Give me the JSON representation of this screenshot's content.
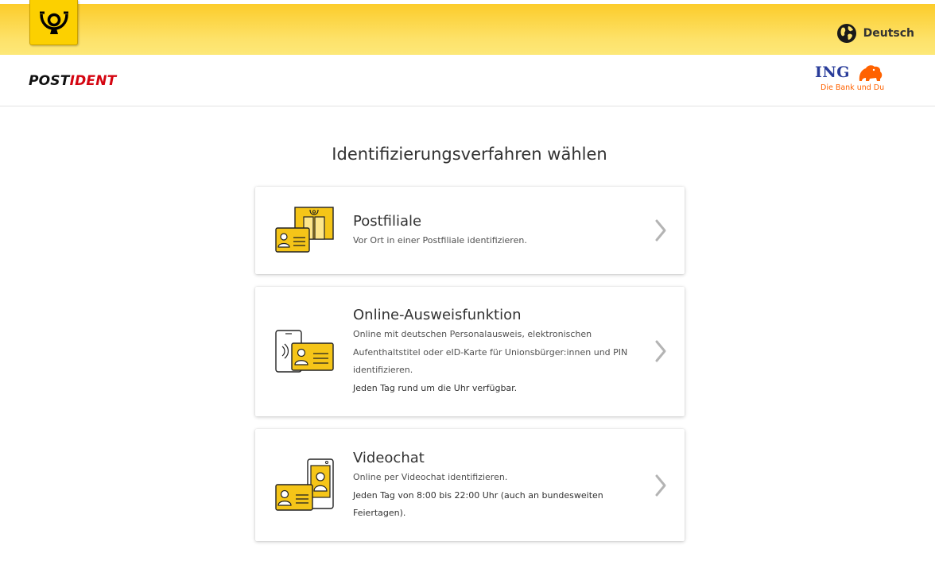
{
  "header": {
    "language_label": "Deutsch",
    "language_icon": "globe-icon",
    "brand_icon": "posthorn-icon"
  },
  "subheader": {
    "postident_part1": "POST",
    "postident_part2": "IDENT",
    "partner_name": "ING",
    "partner_tagline": "Die Bank und Du"
  },
  "page": {
    "title": "Identifizierungsverfahren wählen"
  },
  "options": [
    {
      "title": "Postfiliale",
      "description": "Vor Ort in einer Postfiliale identifizieren.",
      "note": "",
      "icon": "post-office-id-card-icon"
    },
    {
      "title": "Online-Ausweisfunktion",
      "description": "Online mit deutschen Personalausweis, elektronischen Aufenthaltstitel oder eID-Karte für Unionsbürger:innen und PIN identifizieren.",
      "note": "Jeden Tag rund um die Uhr verfügbar.",
      "icon": "phone-nfc-id-card-icon"
    },
    {
      "title": "Videochat",
      "description": "Online per Videochat identifizieren.",
      "note": "Jeden Tag von 8:00 bis 22:00 Uhr (auch an bundesweiten Feiertagen).",
      "icon": "phone-video-id-card-icon"
    }
  ],
  "colors": {
    "post_yellow": "#fccc2a",
    "icon_yellow": "#f5c518",
    "text_dark": "#323232",
    "postident_red": "#d40511",
    "ing_blue": "#2a3d9a",
    "ing_orange": "#ff6200",
    "chevron_grey": "#b4b4b4"
  }
}
